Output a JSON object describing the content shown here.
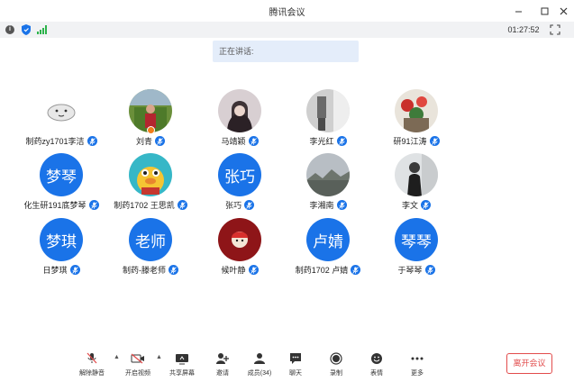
{
  "window": {
    "title": "腾讯会议"
  },
  "infobar": {
    "timer": "01:27:52"
  },
  "banner": {
    "speaking_label": "正在讲话:"
  },
  "participants": [
    {
      "name": "制药zy1701李洁",
      "avatar_text": "",
      "avatar_kind": "cloud"
    },
    {
      "name": "刘青",
      "avatar_text": "",
      "avatar_kind": "photo-garden",
      "host": true
    },
    {
      "name": "马靖颖",
      "avatar_text": "",
      "avatar_kind": "photo-girl"
    },
    {
      "name": "李光红",
      "avatar_text": "",
      "avatar_kind": "photo-room"
    },
    {
      "name": "研91江涛",
      "avatar_text": "",
      "avatar_kind": "photo-flowers"
    },
    {
      "name": "化生研191底梦琴",
      "avatar_text": "梦琴",
      "avatar_kind": "text"
    },
    {
      "name": "制药1702 王思凯",
      "avatar_text": "",
      "avatar_kind": "cartoon-duck"
    },
    {
      "name": "张巧",
      "avatar_text": "张巧",
      "avatar_kind": "text"
    },
    {
      "name": "李湘南",
      "avatar_text": "",
      "avatar_kind": "photo-sky"
    },
    {
      "name": "李文",
      "avatar_text": "",
      "avatar_kind": "photo-person"
    },
    {
      "name": "日梦琪",
      "avatar_text": "梦琪",
      "avatar_kind": "text"
    },
    {
      "name": "制药-滕老师",
      "avatar_text": "老师",
      "avatar_kind": "text"
    },
    {
      "name": "候叶静",
      "avatar_text": "",
      "avatar_kind": "cartoon-red"
    },
    {
      "name": "制药1702 卢婧",
      "avatar_text": "卢婧",
      "avatar_kind": "text"
    },
    {
      "name": "于琴琴",
      "avatar_text": "琴琴",
      "avatar_kind": "text"
    }
  ],
  "toolbar": {
    "mute": "解除静音",
    "video": "开启视频",
    "share": "共享屏幕",
    "invite": "邀请",
    "members": "成员(34)",
    "chat": "聊天",
    "record": "录制",
    "reactions": "表情",
    "more": "更多",
    "leave": "离开会议"
  },
  "colors": {
    "accent": "#1a73e8",
    "danger": "#e24c4c",
    "signal": "#2cb34a"
  }
}
